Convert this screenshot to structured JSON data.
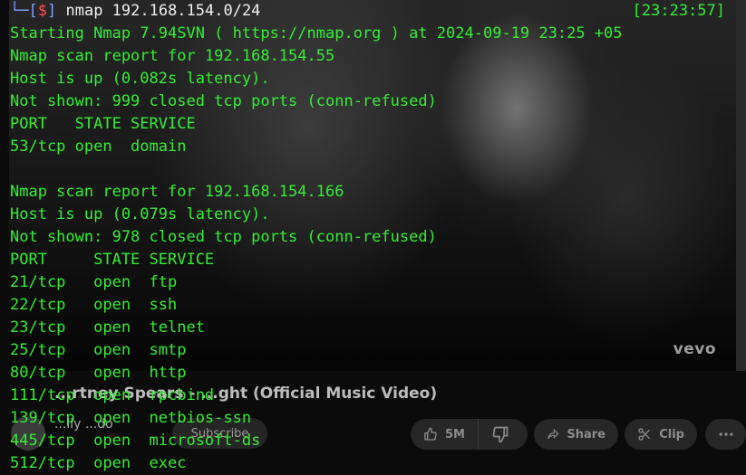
{
  "background": {
    "video": {
      "watermark": "vevo",
      "title": "...rtney Spears - ...ght (Official Music Video)",
      "channel": "...lly ...do",
      "subscribers": "...",
      "subscribe_label": "Subscribe"
    },
    "actions": {
      "likes": "5M",
      "share_label": "Share",
      "clip_label": "Clip"
    }
  },
  "terminal": {
    "prompt": {
      "corner": "└─",
      "open_bracket": "[",
      "symbol": "$",
      "close_bracket": "]",
      "command": "nmap 192.168.154.0/24",
      "time": "[23:23:57]"
    },
    "lines": [
      "Starting Nmap 7.94SVN ( https://nmap.org ) at 2024-09-19 23:25 +05",
      "Nmap scan report for 192.168.154.55",
      "Host is up (0.082s latency).",
      "Not shown: 999 closed tcp ports (conn-refused)",
      "PORT   STATE SERVICE",
      "53/tcp open  domain",
      "",
      "Nmap scan report for 192.168.154.166",
      "Host is up (0.079s latency).",
      "Not shown: 978 closed tcp ports (conn-refused)",
      "PORT     STATE SERVICE",
      "21/tcp   open  ftp",
      "22/tcp   open  ssh",
      "23/tcp   open  telnet",
      "25/tcp   open  smtp",
      "80/tcp   open  http",
      "111/tcp  open  rpcbind",
      "139/tcp  open  netbios-ssn",
      "445/tcp  open  microsoft-ds",
      "512/tcp  open  exec"
    ]
  },
  "colors": {
    "terminal_text": "#33ee33",
    "prompt_accent": "#7f9fff",
    "prompt_symbol": "#ff5050"
  }
}
